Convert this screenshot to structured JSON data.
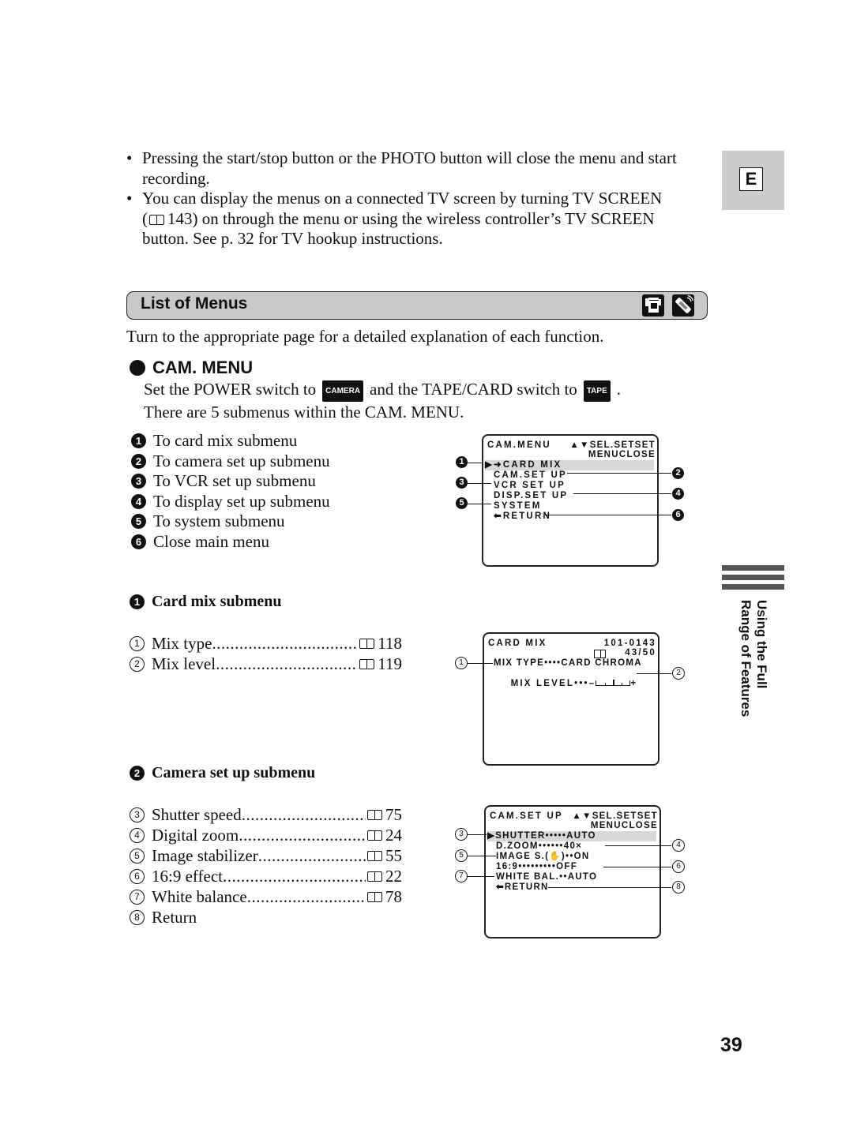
{
  "bullets": [
    "Pressing the start/stop button or the PHOTO button will close the menu and start recording.",
    "You can display the menus on a connected TV screen by turning TV SCREEN ( 143) on through the menu or using the wireless controller’s TV SCREEN button. See p. 32 for TV hookup instructions."
  ],
  "bullet2_parts": {
    "a": "You can display the menus on a connected TV screen by turning TV SCREEN",
    "b_open": "(",
    "b_page": "143) on through the menu or using the wireless controller’s TV SCREEN",
    "c": "button. See p. 32 for TV hookup instructions."
  },
  "language_tab": "E",
  "section": {
    "title": "List of Menus",
    "icons": [
      "camcorder-icon",
      "wireless-controller-icon"
    ],
    "intro": "Turn to the appropriate page for a detailed explanation of each function."
  },
  "cam_menu": {
    "heading": "CAM. MENU",
    "set_line": {
      "before": "Set the POWER switch to",
      "badge1": "CAMERA",
      "middle": "and the TAPE/CARD switch to",
      "badge2": "TAPE",
      "after": "."
    },
    "submenu_count_text": "There are 5 submenus within the CAM. MENU.",
    "items": [
      {
        "num": "1",
        "label": "To card mix submenu"
      },
      {
        "num": "2",
        "label": "To camera set up submenu"
      },
      {
        "num": "3",
        "label": "To VCR set up submenu"
      },
      {
        "num": "4",
        "label": "To display set up submenu"
      },
      {
        "num": "5",
        "label": "To system submenu"
      },
      {
        "num": "6",
        "label": "Close main menu"
      }
    ],
    "osd": {
      "title": "CAM.MENU",
      "sel_set": "▲▼SEL.SETSET",
      "menu_close": "MENUCLOSE",
      "lines": [
        "▶➜CARD MIX",
        "CAM.SET UP",
        "VCR SET UP",
        "DISP.SET UP",
        "SYSTEM",
        "⬅RETURN"
      ]
    }
  },
  "card_mix": {
    "num": "1",
    "heading": "Card mix submenu",
    "items": [
      {
        "num": "1",
        "label": "Mix type",
        "page": "118"
      },
      {
        "num": "2",
        "label": "Mix level",
        "page": "119"
      }
    ],
    "osd": {
      "title": "CARD MIX",
      "file_no": "101-0143",
      "count": "43/50",
      "mix_type": "MIX TYPE••••CARD CHROMA",
      "mix_level_label": "MIX LEVEL•••–",
      "mix_level_plus": "+",
      "mix_level_value": 0.5
    }
  },
  "camera_setup": {
    "num": "2",
    "heading": "Camera set up submenu",
    "items": [
      {
        "num": "3",
        "label": "Shutter speed",
        "page": "75"
      },
      {
        "num": "4",
        "label": "Digital zoom",
        "page": "24"
      },
      {
        "num": "5",
        "label": "Image stabilizer",
        "page": "55"
      },
      {
        "num": "6",
        "label": "16:9 effect",
        "page": "22"
      },
      {
        "num": "7",
        "label": "White balance",
        "page": "78"
      },
      {
        "num": "8",
        "label": "Return",
        "page": ""
      }
    ],
    "osd": {
      "title": "CAM.SET UP",
      "sel_set": "▲▼SEL.SETSET",
      "menu_close": "MENUCLOSE",
      "lines": [
        "▶SHUTTER•••••AUTO",
        "D.ZOOM••••••40×",
        "IMAGE S.(✋)••ON",
        "16:9•••••••••OFF",
        "WHITE BAL.••AUTO",
        "⬅RETURN"
      ]
    }
  },
  "side_tab": {
    "line1": "Using the Full",
    "line2": "Range of Features"
  },
  "page_number": "39"
}
